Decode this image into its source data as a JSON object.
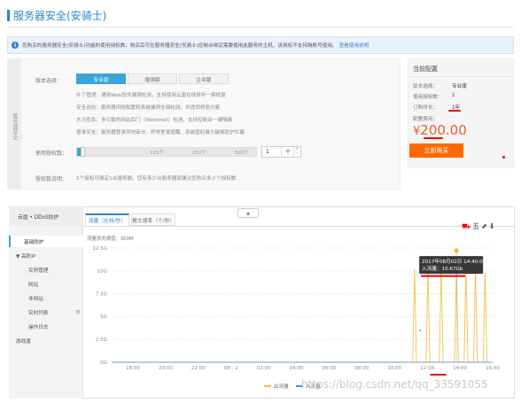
{
  "header": {
    "title": "服务器安全(安骑士)"
  },
  "notice": {
    "text": "您购买的服务器安全(安骑士)功能的使用授权数，购买后可在服务器安全(安骑士)控制台绑定需要使用此服务的主机，该授权不支持跨账号使用。",
    "link": "查看使用说明"
  },
  "config": {
    "side_label": "服务器安全",
    "version_label": "版本选择：",
    "versions": [
      "专业版",
      "增强版",
      "企业版"
    ],
    "selected_version": "专业版",
    "features": [
      "补丁管理：通用Web软件漏洞检测，支持使用云盾在线修补一键修复",
      "安全巡检：服务器风险配置和系统漏洞全面检测，并提供修复方案",
      "木马查杀：多引擎的网站后门（Webshell）检测，支持控制台一键隔离",
      "登录安全：服务器登录异地审计、异常登录提醒、系统密码暴力破解防护拦截"
    ],
    "count_label": "使用授权数：",
    "slider_ticks": [
      "125个",
      "250个",
      "500个"
    ],
    "slider_value": 0.02,
    "count_value": "1",
    "count_unit": "个",
    "count_stepper": [
      "+",
      "-"
    ],
    "desc_label": "授权数说明：",
    "desc_text": "1个授权可绑定1台服务器，您有多少台服务器就建议您购买多少个授权数"
  },
  "cart": {
    "title": "当前配置",
    "rows": [
      {
        "key": "版本选择：",
        "value": "专业版"
      },
      {
        "key": "使用授权数：",
        "value": "1"
      },
      {
        "key": "订购时长：",
        "value": "1年"
      }
    ],
    "fee_label": "配置费用：",
    "currency": "¥",
    "price": "200.00",
    "buy_label": "立即购买",
    "accent": "#ff6a00",
    "price_color": "#f05a28"
  },
  "monitor": {
    "sidebar_header": "云盾 • DDoS防护",
    "sidebar": [
      {
        "label": "基础防护",
        "selected": true,
        "indent": 1
      },
      {
        "label": "▼  高防IP",
        "selected": false,
        "indent": 0
      },
      {
        "label": "实例管理",
        "selected": false,
        "indent": 2
      },
      {
        "label": "网站",
        "selected": false,
        "indent": 2
      },
      {
        "label": "非网站",
        "selected": false,
        "indent": 2
      },
      {
        "label": "实时列表",
        "selected": false,
        "indent": 2
      },
      {
        "label": "操作日志",
        "selected": false,
        "indent": 2
      },
      {
        "label": "游戏盾",
        "selected": false,
        "indent": 0
      }
    ],
    "collapse_icon": "≡",
    "tabs": [
      "流量（比特/秒）",
      "报文速率（个/秒）"
    ],
    "active_tab": 0,
    "handle_label": "▲",
    "tools": [
      "⛟",
      "五",
      "⬈",
      "⬇"
    ],
    "peak_text": "流量清洗阈值：300M"
  },
  "chart_data": {
    "type": "line",
    "ylim": [
      0,
      12.5
    ],
    "yticks": [
      "0G",
      "2.5G",
      "5G",
      "7.5G",
      "10G",
      "12.5G"
    ],
    "xticks": [
      "18:00",
      "20:00",
      "22:00",
      "08 - 2",
      "02:00",
      "04:00",
      "06:00",
      "08:00",
      "10:00",
      "12:00",
      "14:00",
      "16:00"
    ],
    "series": [
      {
        "name": "出流量",
        "color": "#f5b937",
        "points": [
          [
            0.0,
            0
          ],
          [
            0.79,
            0
          ],
          [
            0.795,
            10.2
          ],
          [
            0.8,
            0
          ],
          [
            0.825,
            0
          ],
          [
            0.83,
            10.5
          ],
          [
            0.835,
            0
          ],
          [
            0.86,
            0
          ],
          [
            0.865,
            10.3
          ],
          [
            0.87,
            0
          ],
          [
            0.9,
            0
          ],
          [
            0.905,
            10.67
          ],
          [
            0.91,
            0
          ],
          [
            0.925,
            0
          ],
          [
            0.93,
            10.6
          ],
          [
            0.935,
            0
          ],
          [
            0.95,
            0
          ],
          [
            0.955,
            10.4
          ],
          [
            0.96,
            0
          ],
          [
            0.975,
            0
          ],
          [
            0.98,
            9.8
          ],
          [
            0.985,
            0
          ],
          [
            1.0,
            0
          ]
        ]
      },
      {
        "name": "入流量",
        "color": "#4a90d9",
        "points": [
          [
            0,
            0
          ],
          [
            1,
            0
          ]
        ]
      }
    ],
    "tooltip": {
      "title": "2017年08月02日 14:40:07",
      "label": "入流量：10.67Gb",
      "x": 0.905,
      "y": 10.67
    }
  },
  "watermark": "https://blog.csdn.net/qq_33591055"
}
